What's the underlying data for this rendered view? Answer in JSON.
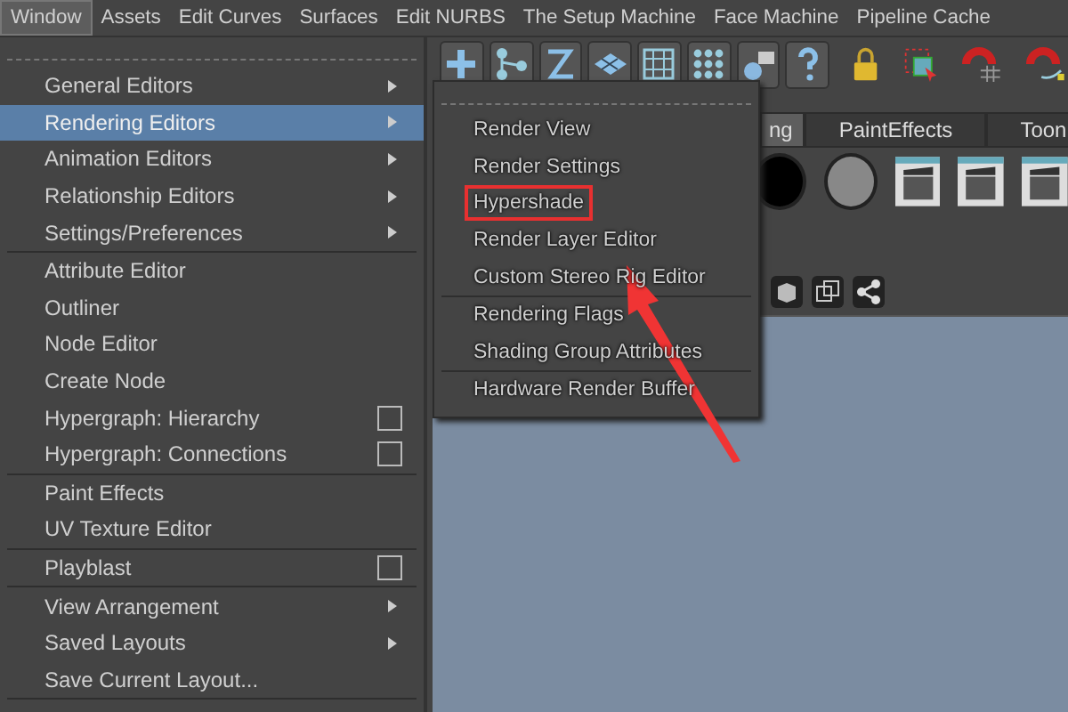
{
  "menu_bar": [
    {
      "label": "Window",
      "selected": true
    },
    {
      "label": "Assets",
      "selected": false
    },
    {
      "label": "Edit Curves",
      "selected": false
    },
    {
      "label": "Surfaces",
      "selected": false
    },
    {
      "label": "Edit NURBS",
      "selected": false
    },
    {
      "label": "The Setup Machine",
      "selected": false
    },
    {
      "label": "Face Machine",
      "selected": false
    },
    {
      "label": "Pipeline Cache",
      "selected": false
    }
  ],
  "window_menu": [
    {
      "kind": "submenu",
      "label": "General Editors",
      "selected": false
    },
    {
      "kind": "submenu",
      "label": "Rendering Editors",
      "selected": true
    },
    {
      "kind": "submenu",
      "label": "Animation Editors",
      "selected": false
    },
    {
      "kind": "submenu",
      "label": "Relationship Editors",
      "selected": false
    },
    {
      "kind": "submenu",
      "label": "Settings/Preferences",
      "selected": false
    },
    {
      "kind": "separator"
    },
    {
      "kind": "item",
      "label": "Attribute Editor",
      "selected": false
    },
    {
      "kind": "item",
      "label": "Outliner",
      "selected": false
    },
    {
      "kind": "item",
      "label": "Node Editor",
      "selected": false
    },
    {
      "kind": "item",
      "label": "Create Node",
      "selected": false
    },
    {
      "kind": "option",
      "label": "Hypergraph: Hierarchy",
      "selected": false,
      "checked": false
    },
    {
      "kind": "option",
      "label": "Hypergraph: Connections",
      "selected": false,
      "checked": false
    },
    {
      "kind": "separator"
    },
    {
      "kind": "item",
      "label": "Paint Effects",
      "selected": false
    },
    {
      "kind": "item",
      "label": "UV Texture Editor",
      "selected": false
    },
    {
      "kind": "separator"
    },
    {
      "kind": "option",
      "label": "Playblast",
      "selected": false,
      "checked": false
    },
    {
      "kind": "separator"
    },
    {
      "kind": "submenu",
      "label": "View Arrangement",
      "selected": false
    },
    {
      "kind": "submenu",
      "label": "Saved Layouts",
      "selected": false
    },
    {
      "kind": "item",
      "label": "Save Current Layout...",
      "selected": false
    },
    {
      "kind": "separator"
    }
  ],
  "rendering_editors_submenu": [
    {
      "kind": "item",
      "label": "Render View",
      "highlighted": false
    },
    {
      "kind": "item",
      "label": "Render Settings",
      "highlighted": false
    },
    {
      "kind": "item",
      "label": "Hypershade",
      "highlighted": true
    },
    {
      "kind": "item",
      "label": "Render Layer Editor",
      "highlighted": false
    },
    {
      "kind": "item",
      "label": "Custom Stereo Rig Editor",
      "highlighted": false
    },
    {
      "kind": "separator"
    },
    {
      "kind": "item",
      "label": "Rendering Flags",
      "highlighted": false
    },
    {
      "kind": "item",
      "label": "Shading Group Attributes",
      "highlighted": false
    },
    {
      "kind": "separator"
    },
    {
      "kind": "item",
      "label": "Hardware Render Buffer",
      "highlighted": false
    }
  ],
  "shelf_tabs": [
    {
      "label": "ng",
      "selected": true
    },
    {
      "label": "PaintEffects",
      "selected": false
    },
    {
      "label": "Toon",
      "selected": false
    }
  ]
}
